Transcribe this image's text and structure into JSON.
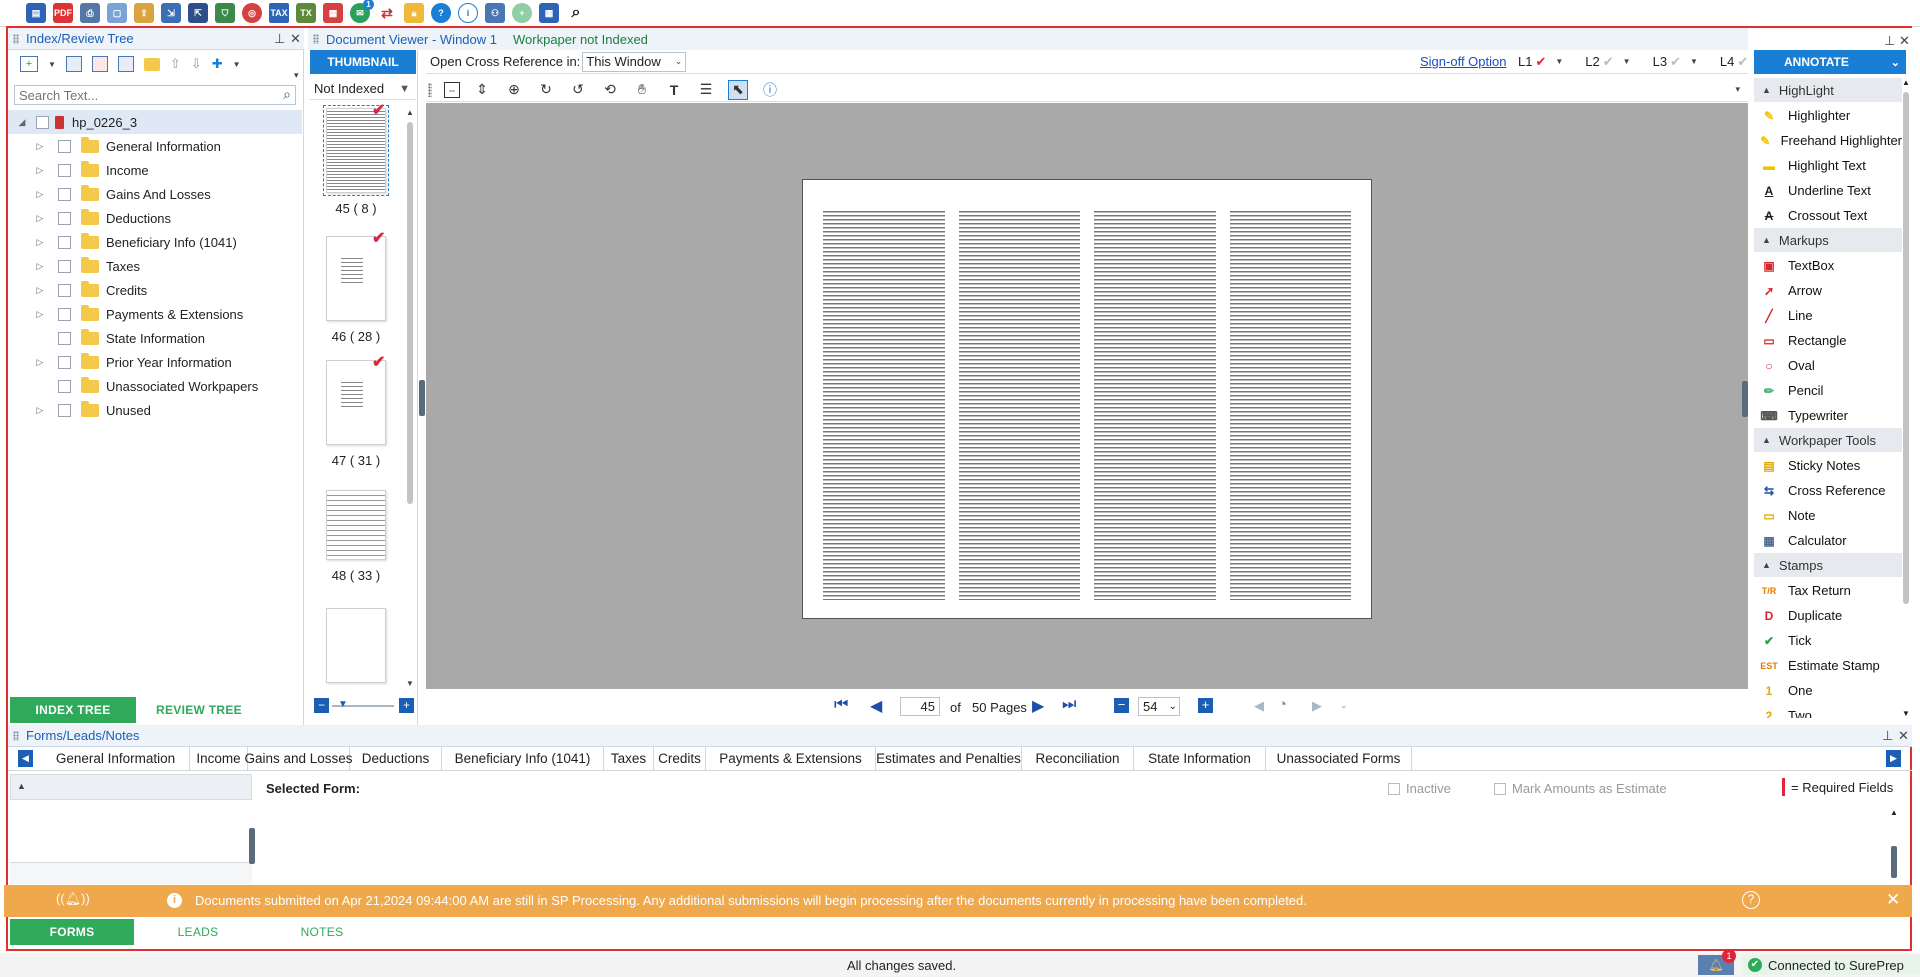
{
  "toolbar": {
    "icons": [
      "save-icon",
      "pdf-icon",
      "print-icon",
      "document-icon",
      "export-icon",
      "tax-file-icon",
      "import-icon",
      "stamp-icon",
      "globe-icon",
      "tax-icon",
      "tax-document-icon",
      "calendar-icon",
      "notification-icon",
      "transfer-icon",
      "lock-icon",
      "help-icon",
      "info-icon",
      "users-icon",
      "plus-circle-icon",
      "grid-icon",
      "search-icon"
    ],
    "notification_count": "1",
    "tax_label": "TAX",
    "tx_label": "TX"
  },
  "index_tree": {
    "title": "Index/Review Tree",
    "search_placeholder": "Search Text...",
    "root": "hp_0226_3",
    "items": [
      {
        "label": "General Information",
        "expandable": true
      },
      {
        "label": "Income",
        "expandable": true
      },
      {
        "label": "Gains And Losses",
        "expandable": true
      },
      {
        "label": "Deductions",
        "expandable": true
      },
      {
        "label": "Beneficiary Info (1041)",
        "expandable": true
      },
      {
        "label": "Taxes",
        "expandable": true
      },
      {
        "label": "Credits",
        "expandable": true
      },
      {
        "label": "Payments & Extensions",
        "expandable": true
      },
      {
        "label": "State Information",
        "expandable": false
      },
      {
        "label": "Prior Year Information",
        "expandable": true
      },
      {
        "label": "Unassociated Workpapers",
        "expandable": false
      },
      {
        "label": "Unused",
        "expandable": true
      }
    ],
    "tabs": {
      "index": "INDEX TREE",
      "review": "REVIEW TREE"
    }
  },
  "thumbnails": {
    "tab": "THUMBNAIL",
    "filter": "Not Indexed",
    "pages": [
      {
        "label": "45 ( 8 )",
        "checked": true
      },
      {
        "label": "46 ( 28 )",
        "checked": true
      },
      {
        "label": "47 ( 31 )",
        "checked": true
      },
      {
        "label": "48 ( 33 )",
        "checked": false
      },
      {
        "label": "",
        "checked": false
      }
    ]
  },
  "viewer": {
    "title": "Document Viewer - Window 1",
    "status": "Workpaper not Indexed",
    "cross_ref_label": "Open Cross Reference in:",
    "cross_ref_value": "This Window",
    "signoff": "Sign-off Option",
    "levels": [
      "L1",
      "L2",
      "L3",
      "L4"
    ],
    "current_page": "45",
    "of_label": "of",
    "total_pages": "50 Pages",
    "zoom": "54"
  },
  "annotate": {
    "title": "ANNOTATE",
    "sections": [
      {
        "label": "HighLight",
        "items": [
          {
            "label": "Highlighter",
            "icon": "highlighter-icon",
            "color": "#f2c200"
          },
          {
            "label": "Freehand Highlighter",
            "icon": "freehand-highlighter-icon",
            "color": "#f2c200"
          },
          {
            "label": "Highlight Text",
            "icon": "highlight-text-icon",
            "color": "#f2c200"
          },
          {
            "label": "Underline Text",
            "icon": "underline-text-icon",
            "color": "#222222"
          },
          {
            "label": "Crossout Text",
            "icon": "crossout-text-icon",
            "color": "#222222"
          }
        ]
      },
      {
        "label": "Markups",
        "items": [
          {
            "label": "TextBox",
            "icon": "textbox-icon",
            "color": "#d9262b"
          },
          {
            "label": "Arrow",
            "icon": "arrow-icon",
            "color": "#d9262b"
          },
          {
            "label": "Line",
            "icon": "line-icon",
            "color": "#d9262b"
          },
          {
            "label": "Rectangle",
            "icon": "rectangle-icon",
            "color": "#d9262b"
          },
          {
            "label": "Oval",
            "icon": "oval-icon",
            "color": "#d9262b"
          },
          {
            "label": "Pencil",
            "icon": "pencil-icon",
            "color": "#3cb371"
          },
          {
            "label": "Typewriter",
            "icon": "typewriter-icon",
            "color": "#555555"
          }
        ]
      },
      {
        "label": "Workpaper Tools",
        "items": [
          {
            "label": "Sticky Notes",
            "icon": "sticky-notes-icon",
            "color": "#e0a800"
          },
          {
            "label": "Cross Reference",
            "icon": "cross-reference-icon",
            "color": "#1e4fa8"
          },
          {
            "label": "Note",
            "icon": "note-icon",
            "color": "#e0a800"
          },
          {
            "label": "Calculator",
            "icon": "calculator-icon",
            "color": "#4a6a90"
          }
        ]
      },
      {
        "label": "Stamps",
        "items": [
          {
            "label": "Tax Return",
            "icon": "tax-return-stamp-icon",
            "glyph": "T/R",
            "color": "#e07b00"
          },
          {
            "label": "Duplicate",
            "icon": "duplicate-stamp-icon",
            "glyph": "D",
            "color": "#d9262b"
          },
          {
            "label": "Tick",
            "icon": "tick-stamp-icon",
            "glyph": "✔",
            "color": "#2e9e4a"
          },
          {
            "label": "Estimate Stamp",
            "icon": "estimate-stamp-icon",
            "glyph": "EST",
            "color": "#e07b00"
          },
          {
            "label": "One",
            "icon": "one-stamp-icon",
            "glyph": "1",
            "color": "#e0a800"
          },
          {
            "label": "Two",
            "icon": "two-stamp-icon",
            "glyph": "2",
            "color": "#e0a800"
          }
        ]
      }
    ]
  },
  "forms": {
    "title": "Forms/Leads/Notes",
    "tabs": [
      "General Information",
      "Income",
      "Gains and Losses",
      "Deductions",
      "Beneficiary Info (1041)",
      "Taxes",
      "Credits",
      "Payments & Extensions",
      "Estimates and Penalties",
      "Reconciliation",
      "State Information",
      "Unassociated Forms"
    ],
    "selected_form_label": "Selected Form:",
    "inactive": "Inactive",
    "mark_estimate": "Mark Amounts as Estimate",
    "required": "= Required Fields",
    "bottom_tabs": [
      "FORMS",
      "LEADS",
      "NOTES"
    ]
  },
  "banner": {
    "message": "Documents submitted on Apr 21,2024 09:44:00 AM are still in SP Processing. Any additional submissions will begin processing after the documents currently in processing have been completed."
  },
  "statusbar": {
    "saved": "All changes saved.",
    "connection": "Connected to SurePrep",
    "bell_count": "1"
  },
  "colors": {
    "accent_blue": "#1a7fd4",
    "green": "#2eaa5a",
    "banner_orange": "#f0a84c",
    "frame_red": "#e03030",
    "check_red": "#e0243a"
  }
}
